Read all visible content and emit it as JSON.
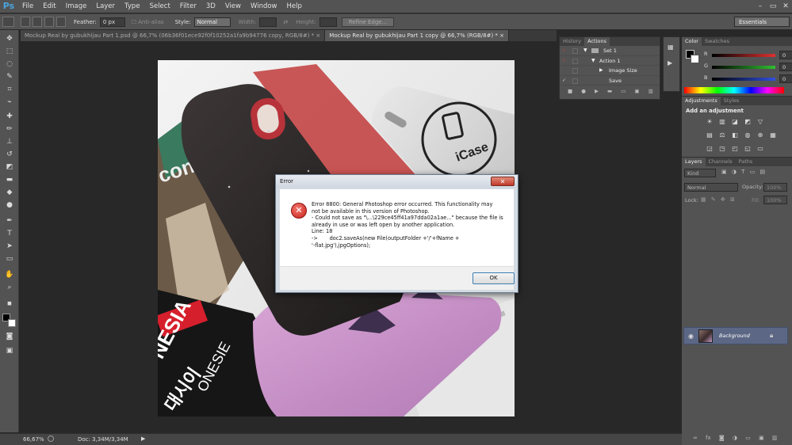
{
  "menubar": {
    "logo": "Ps",
    "items": [
      "File",
      "Edit",
      "Image",
      "Layer",
      "Type",
      "Select",
      "Filter",
      "3D",
      "View",
      "Window",
      "Help"
    ],
    "controls": [
      "–",
      "▭",
      "✕"
    ]
  },
  "options": {
    "feather_label": "Feather:",
    "feather_value": "0 px",
    "antialias_label": "Anti-alias",
    "style_label": "Style:",
    "style_value": "Normal",
    "width_label": "Width:",
    "height_label": "Height:",
    "refine_label": "Refine Edge...",
    "workspace": "Essentials"
  },
  "tabs": [
    {
      "label": "Mockup Real by gubukhijau Part 1.psd @ 66,7% (06b36f01ece92f0f10252a1fa9b94776 copy, RGB/8#) *",
      "close": "×"
    },
    {
      "label": "Mockup Real by gubukhijau Part 1 copy @ 66,7% (RGB/8#) *",
      "close": "×"
    }
  ],
  "status": {
    "zoom": "66,67%",
    "doc": "Doc: 3,34M/3,34M"
  },
  "actions_panel": {
    "tabs": [
      "History",
      "Actions"
    ],
    "rows": [
      "Set 1",
      "Action 1",
      "Image Size",
      "Save"
    ]
  },
  "color_panel": {
    "tabs": [
      "Color",
      "Swatches"
    ],
    "channels": [
      {
        "label": "R",
        "value": "0",
        "color": "#e03030"
      },
      {
        "label": "G",
        "value": "0",
        "color": "#30c030"
      },
      {
        "label": "B",
        "value": "0",
        "color": "#3050e0"
      }
    ]
  },
  "adjustments_panel": {
    "tabs": [
      "Adjustments",
      "Styles"
    ],
    "heading": "Add an adjustment"
  },
  "layers_panel": {
    "tabs": [
      "Layers",
      "Channels",
      "Paths"
    ],
    "kind": "Kind",
    "blend": "Normal",
    "opacity_label": "Opacity:",
    "opacity_value": "100%",
    "lock_label": "Lock:",
    "fill_label": "Fill:",
    "fill_value": "100%",
    "layer_name": "Background"
  },
  "photo_text": {
    "brand": "iCase",
    "magazine1": "NESIA",
    "magazine2": "ONESIE",
    "korean": "대시이",
    "cover": "con"
  },
  "dialog": {
    "title": "Error",
    "close": "✕",
    "icon": "✕",
    "message": "Error 8800: General Photoshop error occurred. This functionality may\nnot be available in this version of Photoshop.\n- Could not save as \"\\...\\229ce45ff41a97dda02a1ae...\" because the file is\nalready in use or was left open by another application.\nLine: 18\n->       doc2.saveAs(new File(outputFolder +'/'+fName +\n'-flat.jpg'),jpgOptions);",
    "ok_label": "OK"
  },
  "colors": {
    "accent": "#3c7fb1",
    "error": "#c8201a",
    "panel": "#535353"
  }
}
